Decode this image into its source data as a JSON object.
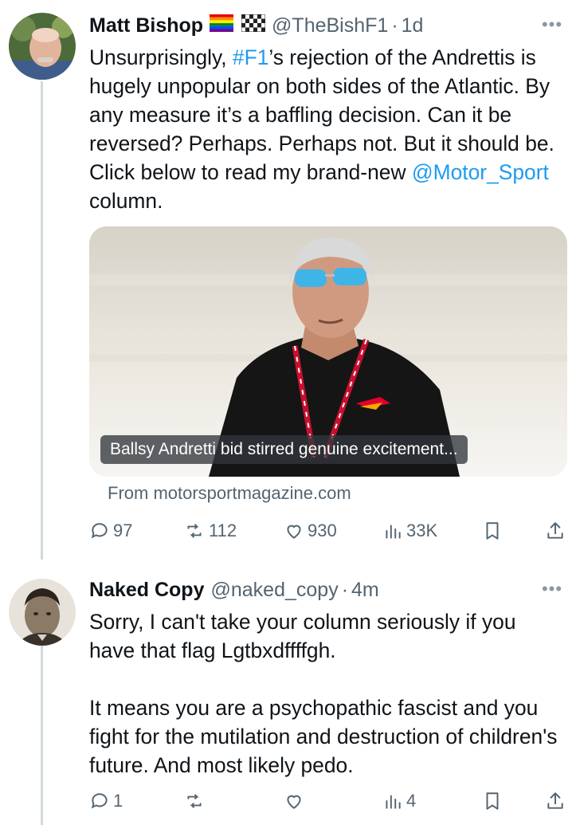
{
  "tweets": [
    {
      "name": "Matt Bishop",
      "handle": "@TheBishF1",
      "separator": "·",
      "time": "1d",
      "text_parts": {
        "p1": "Unsurprisingly, ",
        "hashtag": "#F1",
        "p2": "’s rejection of the Andrettis is hugely unpopular on both sides of the Atlantic. By any measure it’s a baffling decision. Can it be reversed? Perhaps. Perhaps not. But it should be. Click below to read my brand-new ",
        "mention": "@Motor_Sport",
        "p3": " column."
      },
      "card": {
        "caption": "Ballsy Andretti bid stirred genuine excitement...",
        "source": "From motorsportmagazine.com"
      },
      "stats": {
        "replies": "97",
        "retweets": "112",
        "likes": "930",
        "views": "33K"
      },
      "icons": [
        "rainbow-flag-icon",
        "checkered-flag-icon",
        "more-icon"
      ]
    },
    {
      "name": "Naked Copy",
      "handle": "@naked_copy",
      "separator": "·",
      "time": "4m",
      "text_parts": {
        "para1": "Sorry, I can't take your column seriously if you have that flag Lgtbxdffffgh.",
        "para2": "It means you are a psychopathic fascist and you fight for the mutilation and destruction of children's future. And most likely pedo."
      },
      "stats": {
        "replies": "1",
        "retweets": "",
        "likes": "",
        "views": "4"
      },
      "icons": [
        "more-icon"
      ]
    }
  ],
  "colors": {
    "link": "#1d9bf0",
    "secondary_text": "#536471",
    "thread_line": "#cfd9de"
  }
}
